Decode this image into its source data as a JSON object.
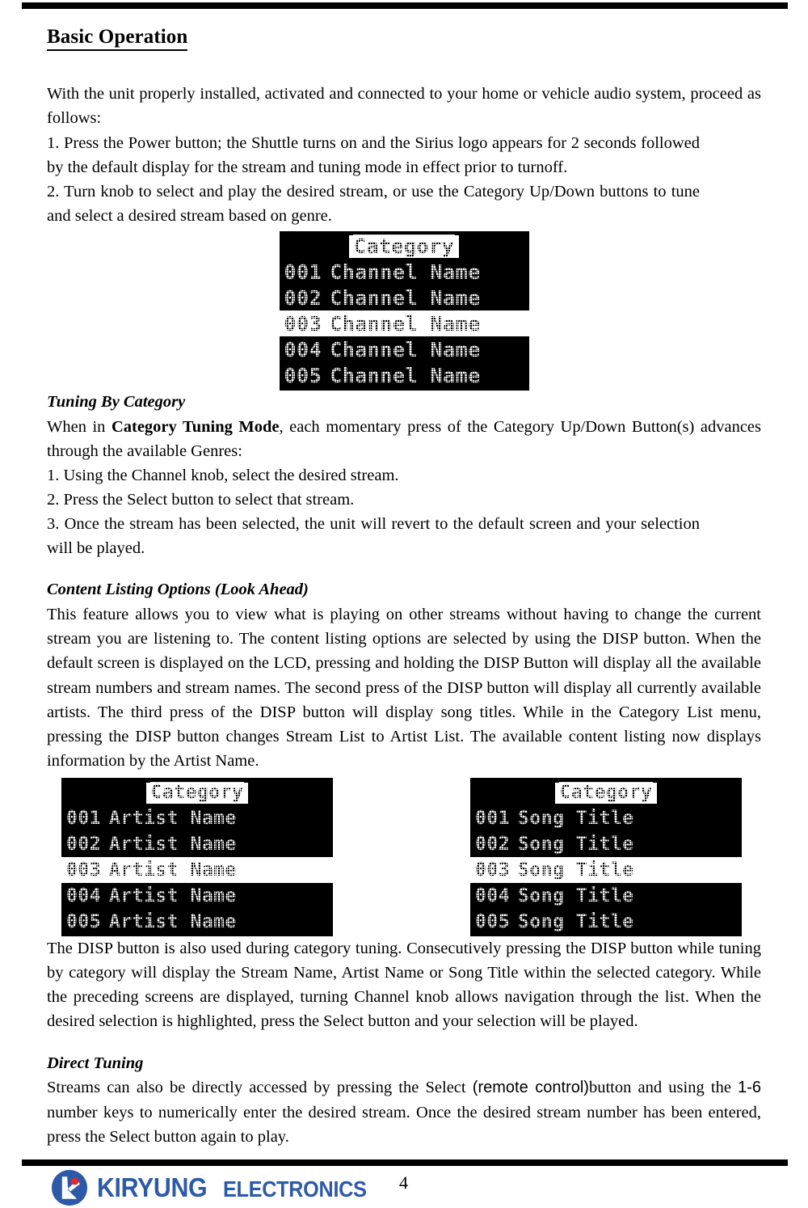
{
  "document": {
    "section_title": "Basic Operation",
    "page_number": "4"
  },
  "intro": {
    "paragraph": "With the unit properly installed, activated and connected to your home or vehicle audio system, proceed as follows:",
    "steps": [
      "1. Press the Power button; the Shuttle turns on and the Sirius logo appears for 2 seconds followed by the default display for the stream and tuning mode in effect prior to turnoff.",
      "2. Turn knob to select and play the desired stream, or use the Category Up/Down buttons to tune and select a desired stream based on genre."
    ]
  },
  "lcd_stream": {
    "header": "Category",
    "rows": [
      {
        "number": "001",
        "label": "Channel Name",
        "selected": false
      },
      {
        "number": "002",
        "label": "Channel Name",
        "selected": false
      },
      {
        "number": "003",
        "label": "Channel Name",
        "selected": true
      },
      {
        "number": "004",
        "label": "Channel Name",
        "selected": false
      },
      {
        "number": "005",
        "label": "Channel Name",
        "selected": false
      }
    ]
  },
  "tuning_by_category": {
    "title": "Tuning By Category",
    "lead_before_bold": "When in ",
    "lead_bold": "Category Tuning Mode",
    "lead_after_bold": ", each momentary press of the Category Up/Down Button(s) advances through the available Genres:",
    "steps": [
      "1. Using the Channel knob, select the desired stream.",
      "2. Press the Select button to select that stream.",
      "3. Once the stream has been selected, the unit will revert to the default screen and your selection will be played."
    ]
  },
  "content_listing": {
    "title": "Content Listing Options (Look Ahead)",
    "paragraph": "This feature allows you to view what is playing on other streams without having to change the current stream you are listening to. The content listing options are selected by using the DISP button. When the default screen is displayed on the LCD, pressing and holding the DISP Button will display all the available stream numbers and stream names. The second press of the DISP button will display all currently available artists. The third press of the DISP button will display song titles. While in the Category List menu, pressing the DISP button changes Stream List to Artist List. The available content listing now displays information by the Artist Name.",
    "paragraph_after": "The DISP button is also used during category tuning. Consecutively pressing the DISP button while tuning by category will display the Stream Name, Artist Name or Song Title within the selected category. While the preceding screens are displayed, turning Channel knob allows navigation through the list. When the desired selection is highlighted, press the Select button and your selection will be played."
  },
  "lcd_artist": {
    "header": "Category",
    "rows": [
      {
        "number": "001",
        "label": "Artist Name",
        "selected": false
      },
      {
        "number": "002",
        "label": "Artist Name",
        "selected": false
      },
      {
        "number": "003",
        "label": "Artist Name",
        "selected": true
      },
      {
        "number": "004",
        "label": "Artist Name",
        "selected": false
      },
      {
        "number": "005",
        "label": "Artist Name",
        "selected": false
      }
    ]
  },
  "lcd_song": {
    "header": "Category",
    "rows": [
      {
        "number": "001",
        "label": "Song Title",
        "selected": false
      },
      {
        "number": "002",
        "label": "Song Title",
        "selected": false
      },
      {
        "number": "003",
        "label": "Song Title",
        "selected": true
      },
      {
        "number": "004",
        "label": "Song Title",
        "selected": false
      },
      {
        "number": "005",
        "label": "Song Title",
        "selected": false
      }
    ]
  },
  "direct_tuning": {
    "title": "Direct Tuning",
    "part1": "Streams can also be directly accessed by pressing the Select ",
    "part2_sans": "(remote control)",
    "part3": "button and using the ",
    "part4_sans": "1-6",
    "part5": " number keys to numerically enter the desired stream. Once the desired stream number has been entered, press the Select button again to play."
  },
  "footer": {
    "brand_name": "KIRYUNG",
    "brand_sub": "ELECTRONICS",
    "brand_color": "#2d5aa8",
    "brand_accent": "#e8252a"
  }
}
